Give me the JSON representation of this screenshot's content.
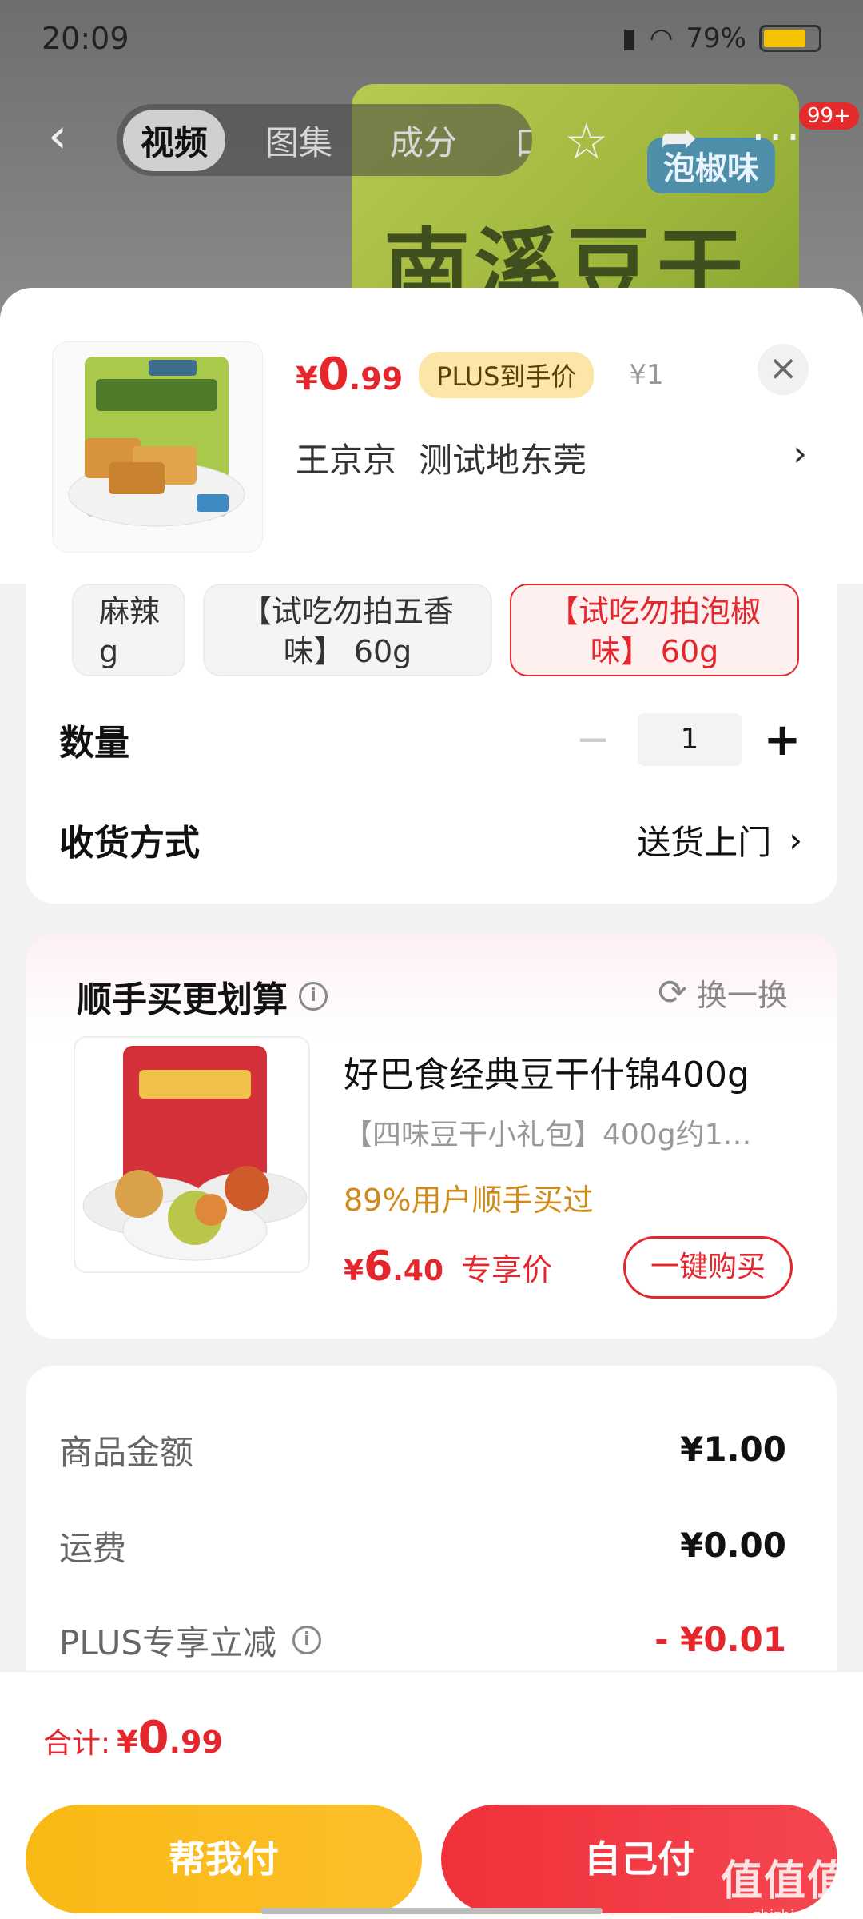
{
  "status_bar": {
    "time": "20:09",
    "battery": "79%"
  },
  "background_page": {
    "tabs": [
      "视频",
      "图集",
      "成分",
      "口碑"
    ],
    "cart_badge": "99+",
    "hero_title": "南溪豆干",
    "hero_flavor": "泡椒味"
  },
  "sheet": {
    "price": {
      "yen": "¥",
      "int": "0",
      "dec": ".99"
    },
    "plus_tag": "PLUS到手价",
    "orig_price": "¥1",
    "address": {
      "name": "王京京",
      "city": "测试地东莞"
    },
    "specs": [
      {
        "line1": "麻辣",
        "line2": "g"
      },
      {
        "line1": "【试吃勿拍五香",
        "line2": "味】 60g"
      },
      {
        "line1": "【试吃勿拍泡椒",
        "line2": "味】 60g"
      }
    ],
    "quantity_label": "数量",
    "quantity_value": "1",
    "delivery_label": "收货方式",
    "delivery_value": "送货上门"
  },
  "upsell": {
    "title": "顺手买更划算",
    "swap": "换一换",
    "name": "好巴食经典豆干什锦400g",
    "desc": "【四味豆干小礼包】400g约1…",
    "stat": "89%用户顺手买过",
    "price": {
      "yen": "¥",
      "int": "6",
      "dec": ".40"
    },
    "price_tag": "专享价",
    "buy_button": "一键购买"
  },
  "summary": {
    "rows": [
      {
        "label": "商品金额",
        "value": "¥1.00"
      },
      {
        "label": "运费",
        "value": "¥0.00"
      },
      {
        "label": "PLUS专享立减",
        "value": "- ¥0.01"
      }
    ]
  },
  "footer": {
    "total_label": "合计:",
    "total": {
      "yen": "¥",
      "int": "0",
      "dec": ".99"
    },
    "help_pay": "帮我付",
    "self_pay": "自己付"
  },
  "watermark": {
    "cn": "值值值",
    "en": "zhizhizhi.com"
  },
  "colors": {
    "accent_red": "#e5262c",
    "plus_gold": "#fbe6a8",
    "help_yellow": "#f9b914"
  }
}
